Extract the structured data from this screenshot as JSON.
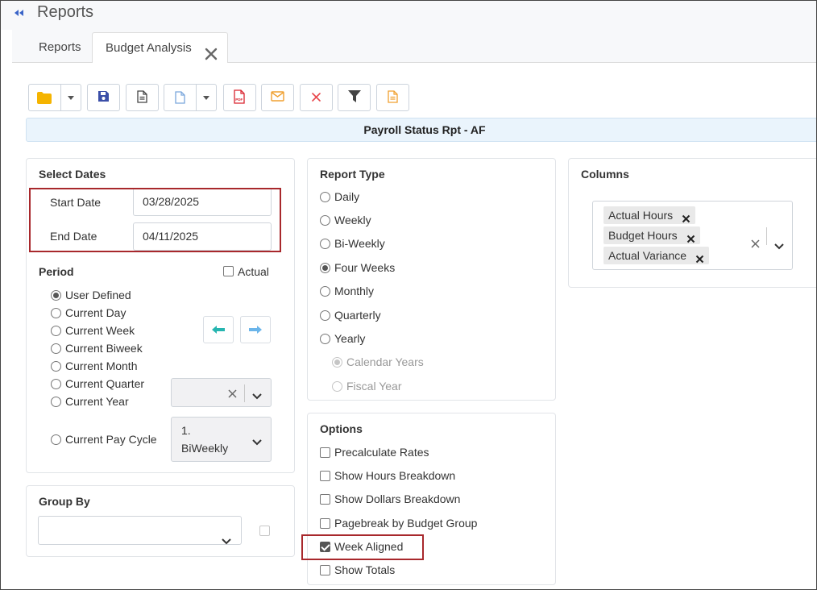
{
  "header": {
    "title": "Reports"
  },
  "tabs": [
    {
      "label": "Reports"
    },
    {
      "label": "Budget Analysis"
    }
  ],
  "toolbar": {
    "buttons": [
      "folder-icon",
      "save-icon",
      "document-icon",
      "new-document-icon",
      "pdf-icon",
      "email-icon",
      "delete-icon",
      "filter-icon",
      "notes-icon"
    ],
    "pdf_label": "PDF"
  },
  "report_title": "Payroll Status Rpt - AF",
  "select_dates": {
    "title": "Select Dates",
    "start_label": "Start Date",
    "start_value": "03/28/2025",
    "end_label": "End Date",
    "end_value": "04/11/2025"
  },
  "period": {
    "title": "Period",
    "actual_label": "Actual",
    "options": [
      "User Defined",
      "Current Day",
      "Current Week",
      "Current Biweek",
      "Current Month",
      "Current Quarter",
      "Current Year",
      "Current Pay Cycle"
    ],
    "selected": "User Defined",
    "pay_cycle_value_line1": "1.",
    "pay_cycle_value_line2": "BiWeekly"
  },
  "group_by": {
    "title": "Group By"
  },
  "report_type": {
    "title": "Report Type",
    "options": [
      "Daily",
      "Weekly",
      "Bi-Weekly",
      "Four Weeks",
      "Monthly",
      "Quarterly",
      "Yearly"
    ],
    "selected": "Four Weeks",
    "sub_options": [
      "Calendar Years",
      "Fiscal Year"
    ],
    "sub_selected": "Calendar Years"
  },
  "options": {
    "title": "Options",
    "items": [
      {
        "label": "Precalculate Rates",
        "checked": false
      },
      {
        "label": "Show Hours Breakdown",
        "checked": false
      },
      {
        "label": "Show Dollars Breakdown",
        "checked": false
      },
      {
        "label": "Pagebreak by Budget Group",
        "checked": false
      },
      {
        "label": "Week Aligned",
        "checked": true
      },
      {
        "label": "Show Totals",
        "checked": false
      }
    ]
  },
  "columns": {
    "title": "Columns",
    "chips": [
      "Actual Hours",
      "Budget Hours",
      "Actual Variance"
    ]
  },
  "colors": {
    "accent_blue": "#3a64c8",
    "folder_yellow": "#f5b400",
    "save_blue": "#3b4fa8",
    "pdf_red": "#d9232e",
    "email_orange": "#f0a030",
    "delete_red": "#e8474c",
    "arrow_teal": "#26b5b0",
    "arrow_lightblue": "#6bb5ea",
    "highlight_red": "#a8282c",
    "title_bar_bg": "#eaf4fc"
  }
}
